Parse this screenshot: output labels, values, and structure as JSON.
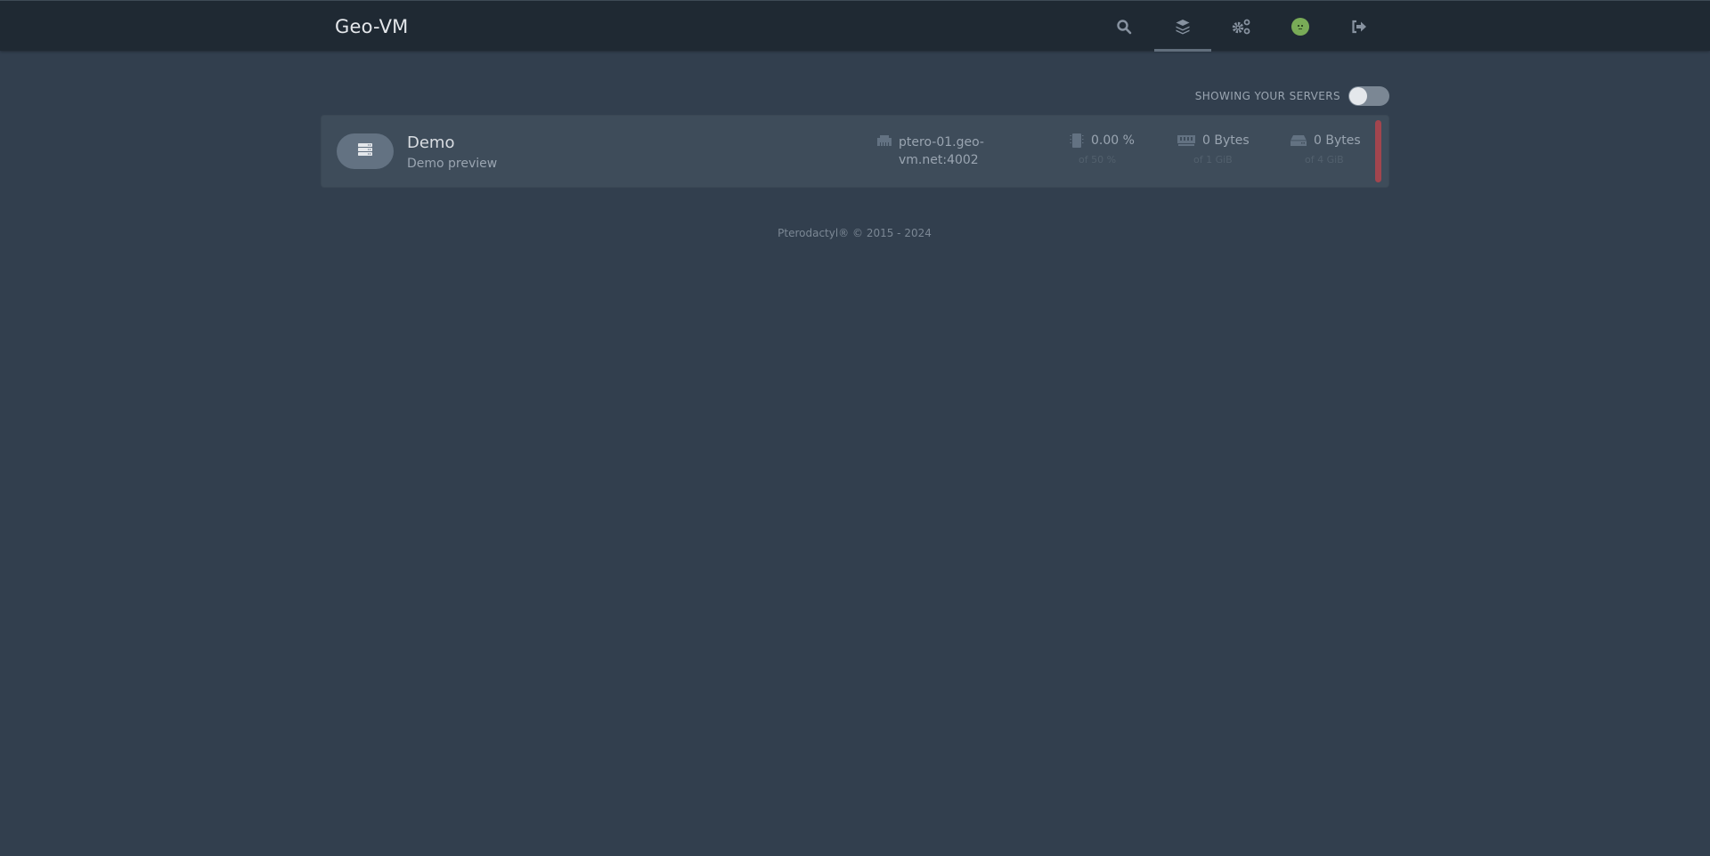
{
  "header": {
    "brand": "Geo-VM",
    "nav": [
      {
        "name": "search",
        "icon": "search-icon",
        "active": false
      },
      {
        "name": "servers",
        "icon": "layers-icon",
        "active": true
      },
      {
        "name": "admin",
        "icon": "cogs-icon",
        "active": false
      },
      {
        "name": "account",
        "icon": "avatar-icon",
        "active": false
      },
      {
        "name": "logout",
        "icon": "sign-out-icon",
        "active": false
      }
    ]
  },
  "filter": {
    "label": "Showing your servers",
    "toggle_on": false
  },
  "servers": [
    {
      "name": "Demo",
      "description": "Demo preview",
      "address": "ptero-01.geo-vm.net:4002",
      "cpu": {
        "value": "0.00 %",
        "limit": "of 50 %"
      },
      "memory": {
        "value": "0 Bytes",
        "limit": "of 1 GiB"
      },
      "disk": {
        "value": "0 Bytes",
        "limit": "of 4 GiB"
      },
      "status_color": "#a2454e"
    }
  ],
  "footer": {
    "text": "Pterodactyl® © 2015 - 2024"
  },
  "colors": {
    "topbar": "#1f2933",
    "background": "#323f4e",
    "card": "#3e4c5a",
    "status_offline": "#a2454e",
    "avatar": "#79ab57"
  }
}
